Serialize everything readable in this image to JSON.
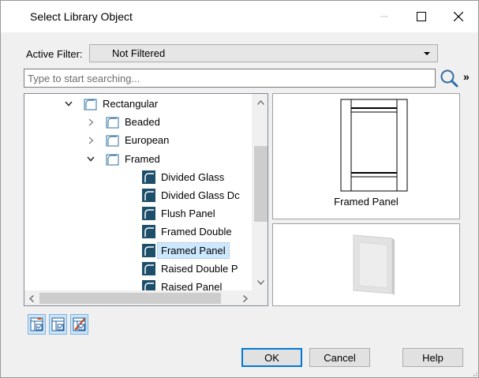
{
  "window": {
    "title": "Select Library Object",
    "minimize_icon": "minimize-icon",
    "maximize_icon": "maximize-icon",
    "close_icon": "close-icon"
  },
  "filter": {
    "label": "Active Filter:",
    "value": "Not Filtered"
  },
  "search": {
    "placeholder": "Type to start searching...",
    "value": "",
    "more_label": "»"
  },
  "tree": {
    "items": [
      {
        "label": "Rectangular",
        "state": "expanded",
        "icon": "folder-icon"
      },
      {
        "label": "Beaded",
        "state": "collapsed",
        "icon": "folder-icon"
      },
      {
        "label": "European",
        "state": "collapsed",
        "icon": "folder-icon"
      },
      {
        "label": "Framed",
        "state": "expanded",
        "icon": "folder-icon"
      },
      {
        "label": "Divided Glass",
        "icon": "door-panel-icon"
      },
      {
        "label": "Divided Glass Dc",
        "icon": "door-panel-icon"
      },
      {
        "label": "Flush Panel",
        "icon": "door-panel-icon"
      },
      {
        "label": "Framed Double",
        "icon": "door-panel-icon"
      },
      {
        "label": "Framed Panel",
        "icon": "door-panel-icon",
        "selected": true
      },
      {
        "label": "Raised Double P",
        "icon": "door-panel-icon"
      },
      {
        "label": "Raised Panel",
        "icon": "door-panel-icon"
      }
    ]
  },
  "preview": {
    "caption": "Framed Panel"
  },
  "buttons": {
    "ok": "OK",
    "cancel": "Cancel",
    "help": "Help"
  },
  "colors": {
    "accent": "#0078d7",
    "selection": "#cce8ff",
    "panel_icon": "#1d4f6b"
  }
}
